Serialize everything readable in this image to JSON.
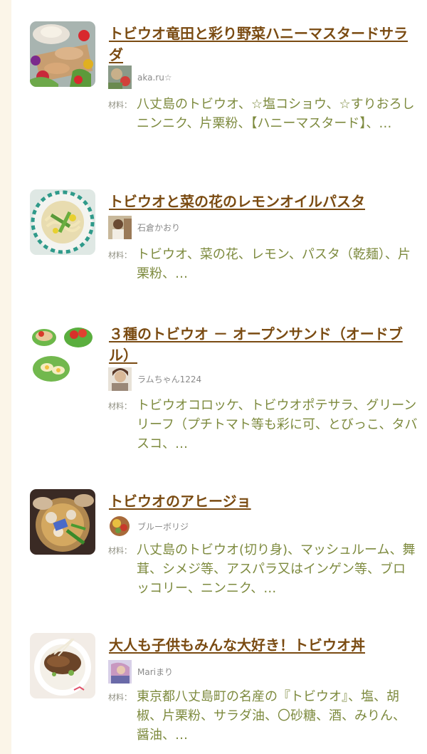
{
  "recipes": [
    {
      "title": "トビウオ竜田と彩り野菜ハニーマスタードサラダ",
      "author": "aka.ru☆",
      "ingredients_label": "材料：",
      "ingredients": "八丈島のトビウオ、☆塩コショウ、☆すりおろしニンニク、片栗粉、【ハニーマスタード】、…"
    },
    {
      "title": "トビウオと菜の花のレモンオイルパスタ",
      "author": "石倉かおり",
      "ingredients_label": "材料：",
      "ingredients": "トビウオ、菜の花、レモン、パスタ（乾麺）、片栗粉、…"
    },
    {
      "title": "３種のトビウオ － オープンサンド（オードブル）",
      "author": "ラムちゃん1224",
      "ingredients_label": "材料：",
      "ingredients": "トビウオコロッケ、トビウオポテサラ、グリーンリーフ（プチトマト等も彩に可、とびっこ、タバスコ、…"
    },
    {
      "title": "トビウオのアヒージョ",
      "author": "ブルーボリジ",
      "ingredients_label": "材料：",
      "ingredients": "八丈島のトビウオ(切り身)、マッシュルーム、舞茸、シメジ等、アスパラ又はインゲン等、ブロッコリー、ニンニク、…"
    },
    {
      "title": "大人も子供もみんな大好き！トビウオ丼",
      "author": "Mariまり",
      "ingredients_label": "材料：",
      "ingredients": "東京都八丈島町の名産の『トビウオ』、塩、胡椒、片栗粉、サラダ油、〇砂糖、酒、みりん、醤油、…"
    }
  ]
}
